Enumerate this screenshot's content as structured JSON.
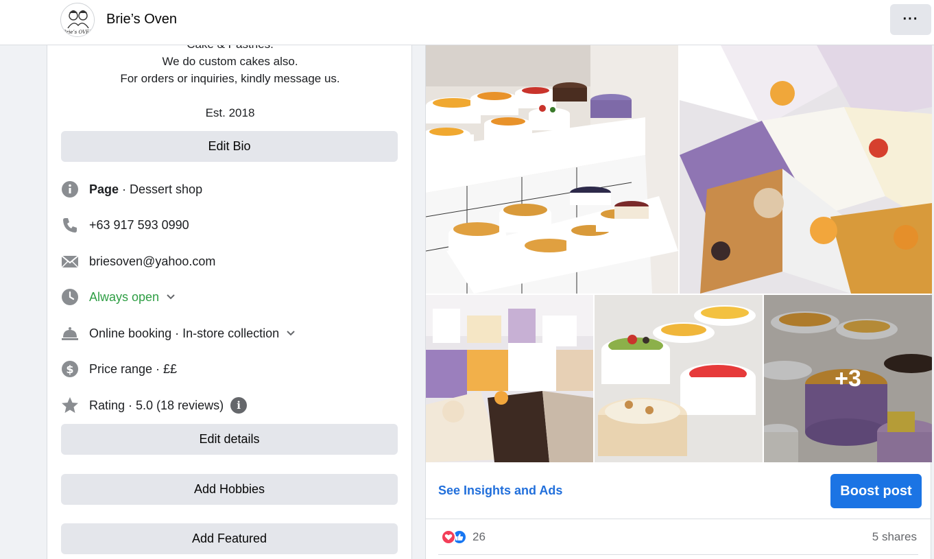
{
  "header": {
    "page_name": "Brie’s Oven",
    "avatar_text": "Brie’s OVEN",
    "more_label": "···"
  },
  "bio": {
    "lines": [
      "Cake & Pastries.",
      "We do custom cakes also.",
      "For orders or inquiries, kindly message us.",
      "",
      "Est. 2018"
    ],
    "edit_label": "Edit Bio"
  },
  "details": {
    "category_prefix": "Page",
    "category": " · Dessert shop",
    "phone": "+63 917 593 0990",
    "email": "briesoven@yahoo.com",
    "hours": "Always open",
    "services": "Online booking · In-store collection",
    "price": "Price range · ££",
    "rating": "Rating · 5.0 (18 reviews)",
    "hours_color": "#2e9e44"
  },
  "buttons": {
    "edit_details": "Edit details",
    "add_hobbies": "Add Hobbies",
    "add_featured": "Add Featured"
  },
  "post": {
    "more_photos": "+3",
    "insights_link": "See Insights and Ads",
    "boost_label": "Boost post",
    "reaction_count": "26",
    "shares": "5 shares",
    "accent": "#1b74e4"
  }
}
